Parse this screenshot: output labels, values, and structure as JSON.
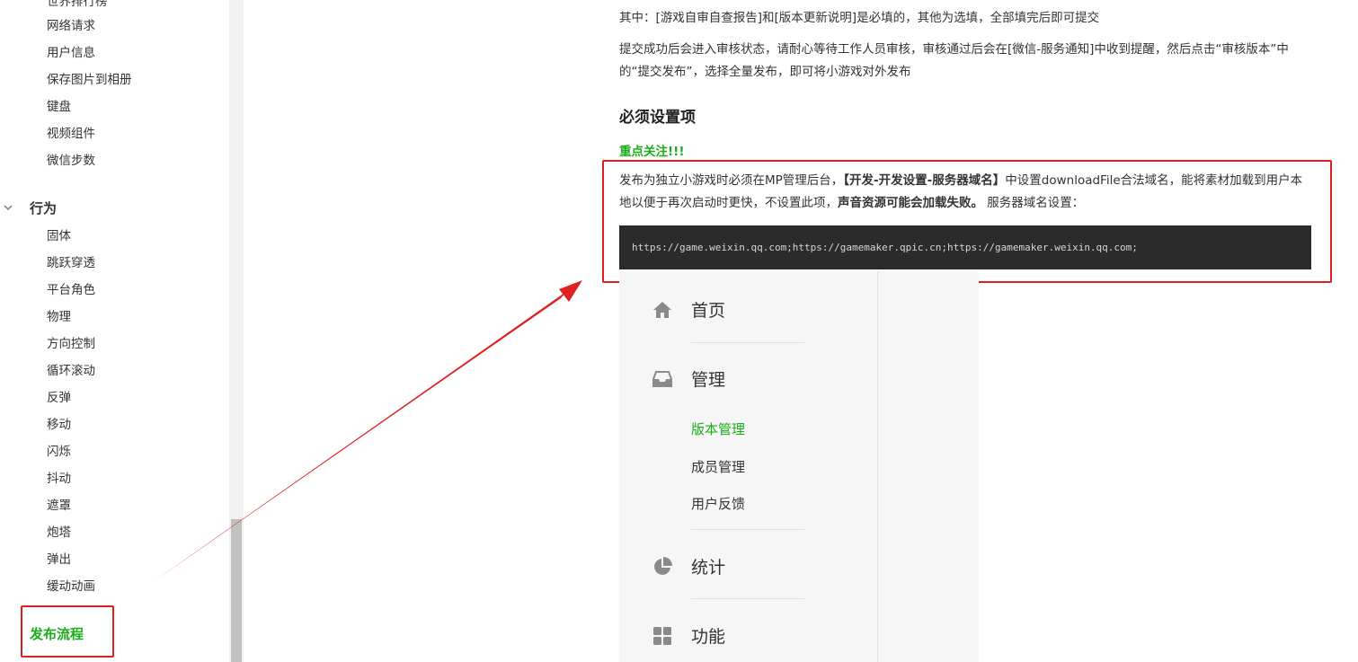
{
  "sidebar": {
    "partial_top": "世界排行榜",
    "items_top": [
      "网络请求",
      "用户信息",
      "保存图片到相册",
      "键盘",
      "视频组件",
      "微信步数"
    ],
    "group_label": "行为",
    "items_behavior": [
      "固体",
      "跳跃穿透",
      "平台角色",
      "物理",
      "方向控制",
      "循环滚动",
      "反弹",
      "移动",
      "闪烁",
      "抖动",
      "遮罩",
      "炮塔",
      "弹出",
      "缓动动画"
    ],
    "active_item": "发布流程"
  },
  "content": {
    "para1": "其中：[游戏自审自查报告]和[版本更新说明]是必填的，其他为选填，全部填完后即可提交",
    "para2": "提交成功后会进入审核状态，请耐心等待工作人员审核，审核通过后会在[微信-服务通知]中收到提醒，然后点击“审核版本”中的“提交发布”，选择全量发布，即可将小游戏对外发布",
    "heading": "必须设置项",
    "focus_note": "重点关注!!!",
    "note_part1": "发布为独立小游戏时必须在MP管理后台，",
    "note_bold1": "【开发-开发设置-服务器域名】",
    "note_part2": "中设置downloadFile合法域名，能将素材加载到用户本地以便于再次启动时更快，不设置此项，",
    "note_bold2": "声音资源可能会加载失败。",
    "note_part3": " 服务器域名设置：",
    "code": "https://game.weixin.qq.com;https://gamemaker.qpic.cn;https://gamemaker.weixin.qq.com;"
  },
  "mp_nav": {
    "home": "首页",
    "manage": "管理",
    "manage_sub": [
      "版本管理",
      "成员管理",
      "用户反馈"
    ],
    "stats": "统计",
    "features": "功能"
  },
  "colors": {
    "accent_green": "#1aad19",
    "highlight_red": "#e02020",
    "code_bg": "#2b2b2b"
  }
}
